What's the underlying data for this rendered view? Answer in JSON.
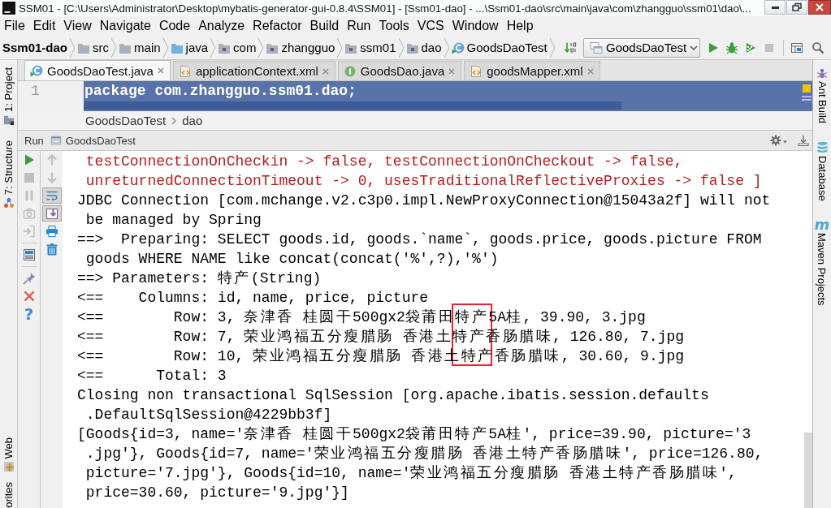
{
  "window": {
    "title": "SSM01 - [C:\\Users\\Administrator\\Desktop\\mybatis-generator-gui-0.8.4\\SSM01] - [Ssm01-dao] - ...\\Ssm01-dao\\src\\main\\java\\com\\zhangguo\\ssm01\\dao\\..."
  },
  "menu": [
    "File",
    "Edit",
    "View",
    "Navigate",
    "Code",
    "Analyze",
    "Refactor",
    "Build",
    "Run",
    "Tools",
    "VCS",
    "Window",
    "Help"
  ],
  "nav_bar": {
    "path": [
      {
        "label": "Ssm01-dao",
        "kind": "module"
      },
      {
        "label": "src",
        "kind": "folder"
      },
      {
        "label": "main",
        "kind": "folder"
      },
      {
        "label": "java",
        "kind": "source-root"
      },
      {
        "label": "com",
        "kind": "package"
      },
      {
        "label": "zhangguo",
        "kind": "package"
      },
      {
        "label": "ssm01",
        "kind": "package"
      },
      {
        "label": "dao",
        "kind": "package"
      },
      {
        "label": "GoodsDaoTest",
        "kind": "test-class"
      }
    ],
    "run_config": "GoodsDaoTest",
    "actions": [
      {
        "kind": "run",
        "disabled": false
      },
      {
        "kind": "debug",
        "disabled": false
      },
      {
        "kind": "coverage",
        "disabled": false
      },
      {
        "kind": "stop",
        "disabled": true
      }
    ]
  },
  "tool_windows": {
    "left": [
      {
        "label": "1: Project",
        "kind": "project"
      },
      {
        "label": "7: Structure",
        "kind": "structure"
      },
      {
        "label": "Web",
        "kind": "web"
      },
      {
        "label": "orites",
        "kind": "favorites"
      }
    ],
    "right": [
      {
        "label": "Ant Build",
        "kind": "ant"
      },
      {
        "label": "Database",
        "kind": "database"
      },
      {
        "label": "Maven Projects",
        "kind": "maven",
        "icon": "m"
      }
    ]
  },
  "tabs": [
    {
      "label": "GoodsDaoTest.java",
      "kind": "test-class",
      "selected": true
    },
    {
      "label": "applicationContext.xml",
      "kind": "xml",
      "selected": false
    },
    {
      "label": "GoodsDao.java",
      "kind": "interface",
      "selected": false
    },
    {
      "label": "goodsMapper.xml",
      "kind": "xml",
      "selected": false
    }
  ],
  "editor": {
    "lines": [
      {
        "number": "1",
        "code": "package com.zhangguo.ssm01.dao;",
        "selected": true
      }
    ]
  },
  "breadcrumb": [
    "GoodsDaoTest",
    "dao"
  ],
  "run_panel": {
    "title": "Run",
    "tab": "GoodsDaoTest",
    "toolbar": [
      [
        {
          "kind": "rerun",
          "disabled": false
        },
        {
          "kind": "stop",
          "disabled": true
        },
        {
          "kind": "pause",
          "disabled": true
        },
        {
          "kind": "dump",
          "disabled": true
        },
        {
          "kind": "exit",
          "disabled": true
        }
      ],
      [
        {
          "kind": "layout",
          "disabled": false
        }
      ],
      [
        {
          "kind": "pin",
          "disabled": false
        },
        {
          "kind": "close",
          "disabled": false
        },
        {
          "kind": "help",
          "disabled": false,
          "glyph": "?"
        }
      ]
    ],
    "console_toolbar": [
      {
        "kind": "up",
        "disabled": true,
        "on": false
      },
      {
        "kind": "down",
        "disabled": true,
        "on": false
      },
      {
        "kind": "wrap",
        "disabled": false,
        "on": true
      },
      {
        "kind": "scroll-end",
        "disabled": false,
        "on": true
      },
      {
        "kind": "print",
        "disabled": false,
        "on": false
      },
      {
        "kind": "clear",
        "disabled": false,
        "on": false
      }
    ],
    "console": [
      {
        "text": "testConnectionOnCheckin -> false, testConnectionOnCheckout -> false,",
        "kind": "error",
        "continued": true
      },
      {
        "text": "unreturnedConnectionTimeout -> 0, usesTraditionalReflectiveProxies -> false ]",
        "kind": "error",
        "continued": true
      },
      {
        "text": "JDBC Connection [com.mchange.v2.c3p0.impl.NewProxyConnection@15043a2f] will not",
        "kind": "output",
        "continued": false
      },
      {
        "text": "be managed by Spring",
        "kind": "output",
        "continued": true
      },
      {
        "text": "==>  Preparing: SELECT goods.id, goods.`name`, goods.price, goods.picture FROM",
        "kind": "output",
        "continued": false
      },
      {
        "text": "goods WHERE NAME like concat(concat('%',?),'%')",
        "kind": "output",
        "continued": true
      },
      {
        "text": "==> Parameters: 特产(String)",
        "kind": "output",
        "continued": false
      },
      {
        "text": "<==    Columns: id, name, price, picture",
        "kind": "output",
        "continued": false
      },
      {
        "text": "<==        Row: 3, 奈津香 桂圆干500gx2袋莆田特产5A桂, 39.90, 3.jpg",
        "kind": "output",
        "continued": false
      },
      {
        "text": "<==        Row: 7, 荣业鸿福五分瘦腊肠 香港土特产香肠腊味, 126.80, 7.jpg",
        "kind": "output",
        "continued": false
      },
      {
        "text": "<==        Row: 10, 荣业鸿福五分瘦腊肠 香港土特产香肠腊味, 30.60, 9.jpg",
        "kind": "output",
        "continued": false
      },
      {
        "text": "<==      Total: 3",
        "kind": "output",
        "continued": false
      },
      {
        "text": "Closing non transactional SqlSession [org.apache.ibatis.session.defaults",
        "kind": "output",
        "continued": false
      },
      {
        "text": ".DefaultSqlSession@4229bb3f]",
        "kind": "output",
        "continued": true
      },
      {
        "text": "[Goods{id=3, name='奈津香 桂圆干500gx2袋莆田特产5A桂', price=39.90, picture='3",
        "kind": "output",
        "continued": false
      },
      {
        "text": ".jpg'}, Goods{id=7, name='荣业鸿福五分瘦腊肠 香港土特产香肠腊味', price=126.80,",
        "kind": "output",
        "continued": true
      },
      {
        "text": "picture='7.jpg'}, Goods{id=10, name='荣业鸿福五分瘦腊肠 香港土特产香肠腊味',",
        "kind": "output",
        "continued": true
      },
      {
        "text": "price=30.60, picture='9.jpg'}]",
        "kind": "output",
        "continued": true
      }
    ]
  }
}
